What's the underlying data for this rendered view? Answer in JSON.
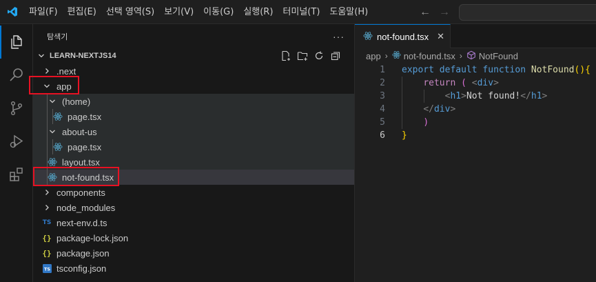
{
  "menu": [
    "파일(F)",
    "편집(E)",
    "선택 영역(S)",
    "보기(V)",
    "이동(G)",
    "실행(R)",
    "터미널(T)",
    "도움말(H)"
  ],
  "nav": {
    "back": "←",
    "forward": "→"
  },
  "sidebar": {
    "title": "탐색기",
    "more": "···",
    "project": "LEARN-NEXTJS14",
    "tree": [
      {
        "label": ".next",
        "kind": "folder",
        "depth": 1,
        "expanded": false
      },
      {
        "label": "app",
        "kind": "folder",
        "depth": 1,
        "expanded": true
      },
      {
        "label": "(home)",
        "kind": "folder",
        "depth": 2,
        "expanded": true
      },
      {
        "label": "page.tsx",
        "kind": "react",
        "depth": 3
      },
      {
        "label": "about-us",
        "kind": "folder",
        "depth": 2,
        "expanded": true
      },
      {
        "label": "page.tsx",
        "kind": "react",
        "depth": 3
      },
      {
        "label": "layout.tsx",
        "kind": "react",
        "depth": 2
      },
      {
        "label": "not-found.tsx",
        "kind": "react",
        "depth": 2
      },
      {
        "label": "components",
        "kind": "folder",
        "depth": 1,
        "expanded": false
      },
      {
        "label": "node_modules",
        "kind": "folder",
        "depth": 1,
        "expanded": false
      },
      {
        "label": "next-env.d.ts",
        "kind": "ts",
        "depth": 1
      },
      {
        "label": "package-lock.json",
        "kind": "json",
        "depth": 1
      },
      {
        "label": "package.json",
        "kind": "json",
        "depth": 1
      },
      {
        "label": "tsconfig.json",
        "kind": "tsconfig",
        "depth": 1
      }
    ]
  },
  "editor": {
    "tab": {
      "label": "not-found.tsx",
      "close": "✕"
    },
    "breadcrumbs": {
      "folder": "app",
      "file": "not-found.tsx",
      "symbol": "NotFound"
    },
    "code": [
      {
        "no": "1",
        "tokens": [
          [
            "kw",
            "export"
          ],
          [
            "txt",
            " "
          ],
          [
            "kw",
            "default"
          ],
          [
            "txt",
            " "
          ],
          [
            "kw",
            "function"
          ],
          [
            "txt",
            " "
          ],
          [
            "fn",
            "NotFound"
          ],
          [
            "br1",
            "()"
          ],
          [
            "br1",
            "{"
          ]
        ]
      },
      {
        "no": "2",
        "tokens": [
          [
            "txt",
            "    "
          ],
          [
            "kw2",
            "return"
          ],
          [
            "txt",
            " "
          ],
          [
            "br2",
            "("
          ],
          [
            "txt",
            " "
          ],
          [
            "tagp",
            "<"
          ],
          [
            "tag",
            "div"
          ],
          [
            "tagp",
            ">"
          ]
        ]
      },
      {
        "no": "3",
        "tokens": [
          [
            "txt",
            "        "
          ],
          [
            "tagp",
            "<"
          ],
          [
            "tag",
            "h1"
          ],
          [
            "tagp",
            ">"
          ],
          [
            "txt",
            "Not found!"
          ],
          [
            "tagp",
            "</"
          ],
          [
            "tag",
            "h1"
          ],
          [
            "tagp",
            ">"
          ]
        ]
      },
      {
        "no": "4",
        "tokens": [
          [
            "txt",
            "    "
          ],
          [
            "tagp",
            "</"
          ],
          [
            "tag",
            "div"
          ],
          [
            "tagp",
            ">"
          ]
        ]
      },
      {
        "no": "5",
        "tokens": [
          [
            "txt",
            "    "
          ],
          [
            "br2",
            ")"
          ]
        ]
      },
      {
        "no": "6",
        "tokens": [
          [
            "br1",
            "}"
          ]
        ]
      }
    ]
  },
  "colors": {
    "accent": "#0078d4",
    "highlight": "#e81123",
    "react": "#519aba"
  }
}
